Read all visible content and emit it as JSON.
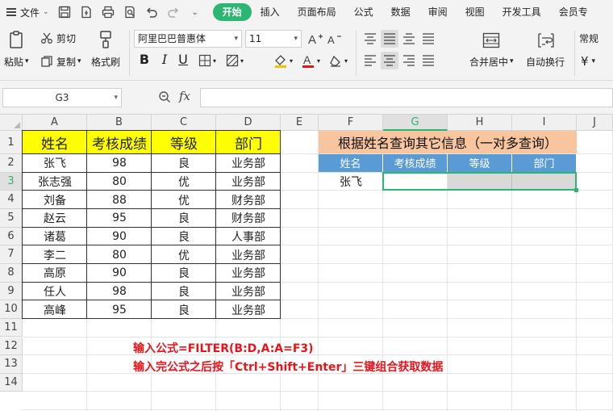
{
  "menubar": {
    "file_label": "文件",
    "tabs": [
      "开始",
      "插入",
      "页面布局",
      "公式",
      "数据",
      "审阅",
      "视图",
      "开发工具",
      "会员专"
    ],
    "active_tab": "开始"
  },
  "ribbon": {
    "paste": "粘贴",
    "cut": "剪切",
    "copy": "复制",
    "format_painter": "格式刷",
    "font_name": "阿里巴巴普惠体",
    "font_size": "11",
    "merge_center": "合并居中",
    "wrap_text": "自动换行",
    "number_format": "常规",
    "currency_symbol": "¥"
  },
  "formula_bar": {
    "name_box": "G3",
    "fx_label": "fx",
    "formula": ""
  },
  "sheet": {
    "columns": [
      "A",
      "B",
      "C",
      "D",
      "E",
      "F",
      "G",
      "H",
      "I",
      "J"
    ],
    "rows": [
      "1",
      "2",
      "3",
      "4",
      "5",
      "6",
      "7",
      "8",
      "9",
      "10",
      "11",
      "12",
      "13",
      "14"
    ],
    "selected_cell": "G3",
    "headers": [
      "姓名",
      "考核成绩",
      "等级",
      "部门"
    ],
    "data": [
      [
        "张飞",
        "98",
        "良",
        "业务部"
      ],
      [
        "张志强",
        "80",
        "优",
        "业务部"
      ],
      [
        "刘备",
        "88",
        "优",
        "财务部"
      ],
      [
        "赵云",
        "95",
        "良",
        "财务部"
      ],
      [
        "诸葛",
        "90",
        "良",
        "人事部"
      ],
      [
        "李二",
        "80",
        "优",
        "业务部"
      ],
      [
        "高原",
        "90",
        "良",
        "业务部"
      ],
      [
        "任人",
        "98",
        "良",
        "业务部"
      ],
      [
        "高峰",
        "95",
        "良",
        "业务部"
      ]
    ],
    "lookup_title": "根据姓名查询其它信息（一对多查询）",
    "lookup_headers": [
      "姓名",
      "考核成绩",
      "等级",
      "部门"
    ],
    "lookup_name": "张飞",
    "notes": [
      "输入公式=FILTER(B:D,A:A=F3)",
      "输入完公式之后按「Ctrl+Shift+Enter」三键组合获取数据"
    ]
  },
  "colors": {
    "accent": "#2bb673",
    "header_yellow": "#ffff00",
    "banner_peach": "#f8c59e",
    "header_blue": "#5b9bd5",
    "note_red": "#e8141b"
  }
}
